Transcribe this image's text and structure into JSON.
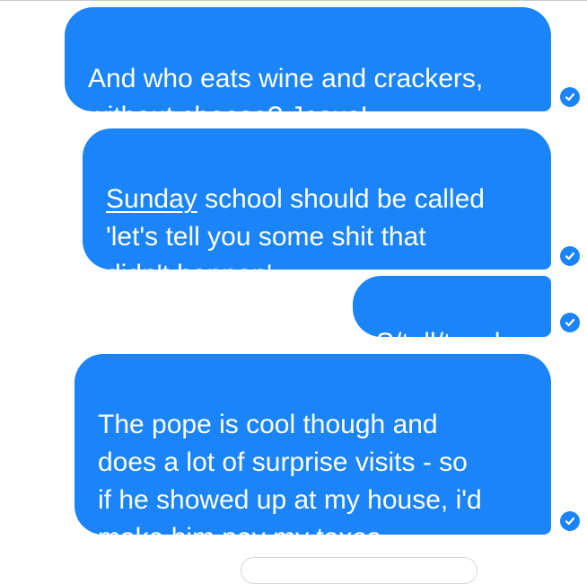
{
  "colors": {
    "bubble": "#1a84f8",
    "bubble_text": "#ffffff",
    "background": "#ffffff"
  },
  "messages": [
    {
      "text": "And who eats wine and crackers,\nwithout cheese? Jesus!",
      "status_icon": "check-circle-icon"
    },
    {
      "underlined_word": "Sunday",
      "rest": " school should be called\n'let's tell you some shit that\ndidn't happen'",
      "status_icon": "check-circle-icon"
    },
    {
      "text": "S/tell/teach",
      "status_icon": "check-circle-icon"
    },
    {
      "text": "The pope is cool though and\ndoes a lot of surprise visits - so\nif he showed up at my house, i'd\nmake him pay my taxes",
      "status_icon": "check-circle-icon"
    }
  ]
}
